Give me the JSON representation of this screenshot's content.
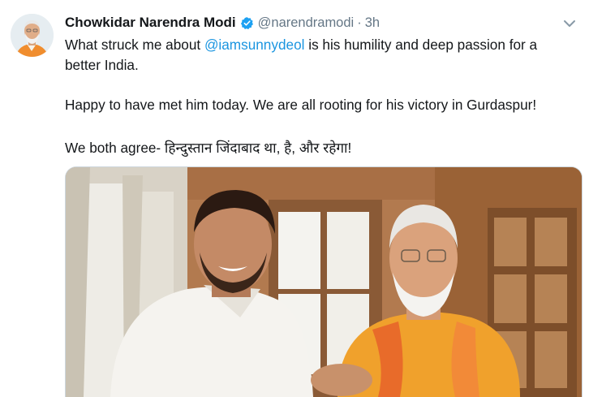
{
  "tweet": {
    "display_name": "Chowkidar Narendra Modi",
    "handle": "@narendramodi",
    "separator": "·",
    "timestamp": "3h",
    "line1_prefix": "What struck me about ",
    "mention": "@iamsunnydeol",
    "line1_suffix": " is his humility and deep passion for a better India.",
    "paragraph2": "Happy to have met him today. We are all rooting for his victory in Gurdaspur!",
    "paragraph3": "We both agree- हिन्दुस्तान जिंदाबाद था, है, और रहेगा!"
  },
  "icons": {
    "verified": "verified-badge-icon",
    "caret": "chevron-down-icon"
  },
  "colors": {
    "link": "#1b95e0",
    "verified": "#1da1f2",
    "secondary_text": "#657786",
    "primary_text": "#14171a"
  }
}
